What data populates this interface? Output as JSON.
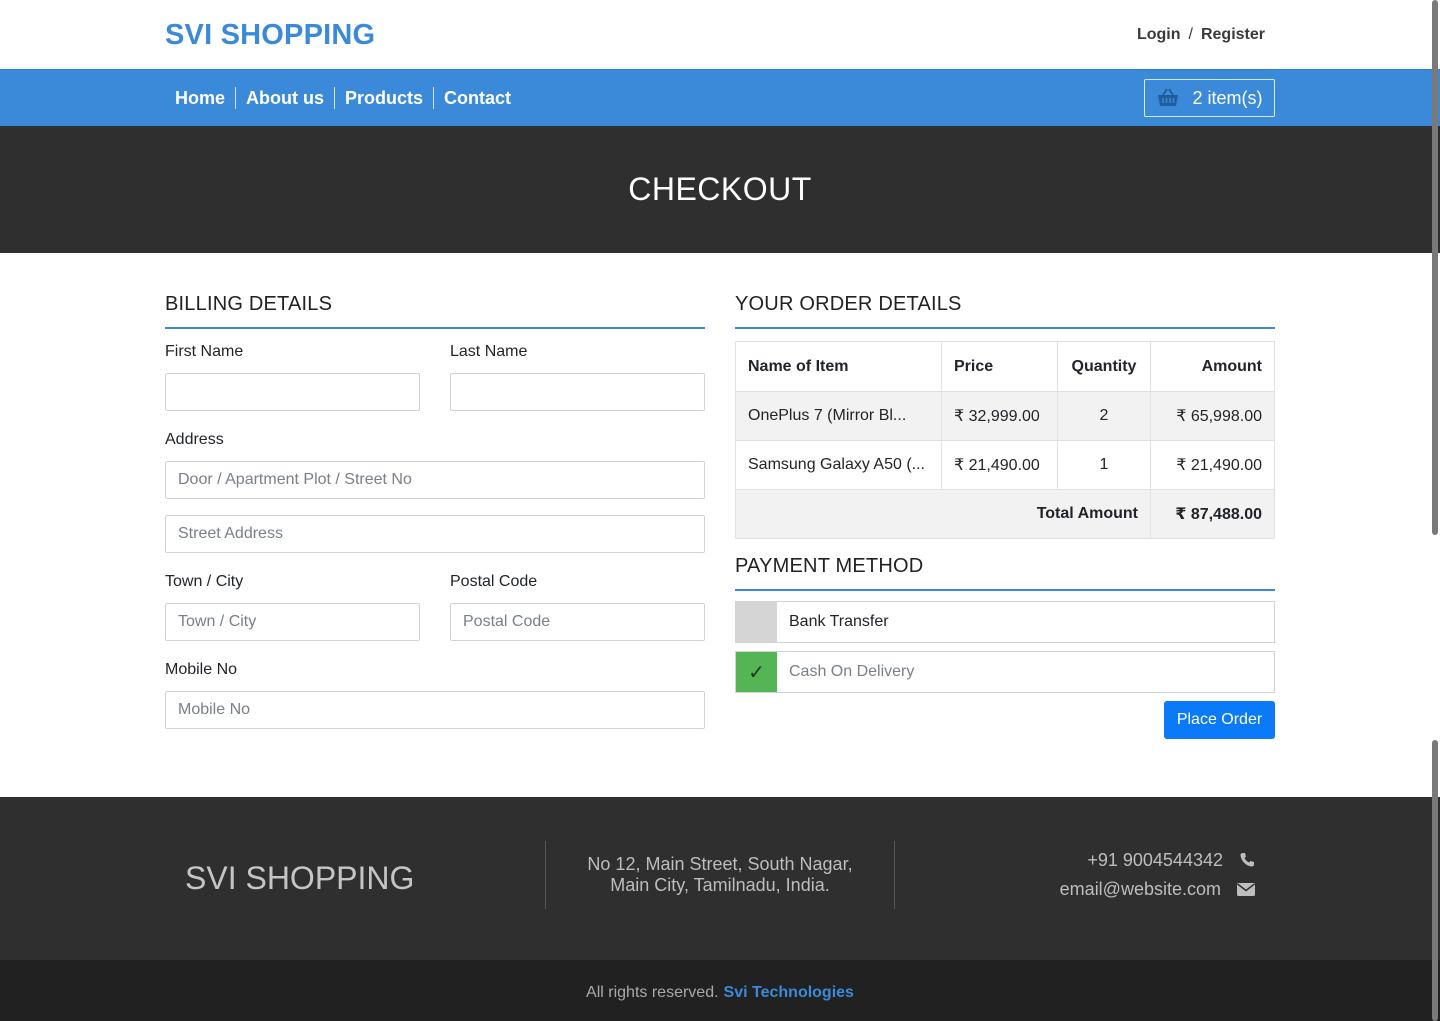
{
  "header": {
    "brand": "SVI SHOPPING",
    "login": "Login",
    "separator": "/",
    "register": "Register"
  },
  "nav": {
    "items": [
      "Home",
      "About us",
      "Products",
      "Contact"
    ],
    "cart_label": "2 item(s)",
    "cart_icon": "basket-icon"
  },
  "hero": {
    "title": "CHECKOUT"
  },
  "billing": {
    "title": "BILLING DETAILS",
    "first_name_label": "First Name",
    "first_name_value": "",
    "last_name_label": "Last Name",
    "last_name_value": "",
    "address_label": "Address",
    "address1_placeholder": "Door / Apartment Plot / Street No",
    "address2_placeholder": "Street Address",
    "city_label": "Town / City",
    "city_placeholder": "Town / City",
    "postal_label": "Postal Code",
    "postal_placeholder": "Postal Code",
    "mobile_label": "Mobile No",
    "mobile_placeholder": "Mobile No"
  },
  "order": {
    "title": "YOUR ORDER DETAILS",
    "headers": {
      "item": "Name of Item",
      "price": "Price",
      "quantity": "Quantity",
      "amount": "Amount"
    },
    "rows": [
      {
        "item": "OnePlus 7 (Mirror Bl...",
        "price": "₹ 32,999.00",
        "quantity": "2",
        "amount": "₹ 65,998.00"
      },
      {
        "item": "Samsung Galaxy A50 (...",
        "price": "₹ 21,490.00",
        "quantity": "1",
        "amount": "₹ 21,490.00"
      }
    ],
    "total_label": "Total Amount",
    "total_value": "₹ 87,488.00"
  },
  "payment": {
    "title": "PAYMENT METHOD",
    "options": [
      {
        "label": "Bank Transfer",
        "checked": false
      },
      {
        "label": "Cash On Delivery",
        "checked": true
      }
    ],
    "checkmark": "✓",
    "place_order_label": "Place Order"
  },
  "footer": {
    "brand": "SVI SHOPPING",
    "address_line1": "No 12, Main Street, South Nagar,",
    "address_line2": "Main City, Tamilnadu, India.",
    "phone": "+91 9004544342",
    "email": "email@website.com",
    "copyright": "All rights reserved.",
    "company": "Svi Technologies"
  },
  "colors": {
    "accent": "#3a8ad9",
    "dark": "#2f2f2f",
    "button": "#0a7af8",
    "checked": "#53b553"
  }
}
